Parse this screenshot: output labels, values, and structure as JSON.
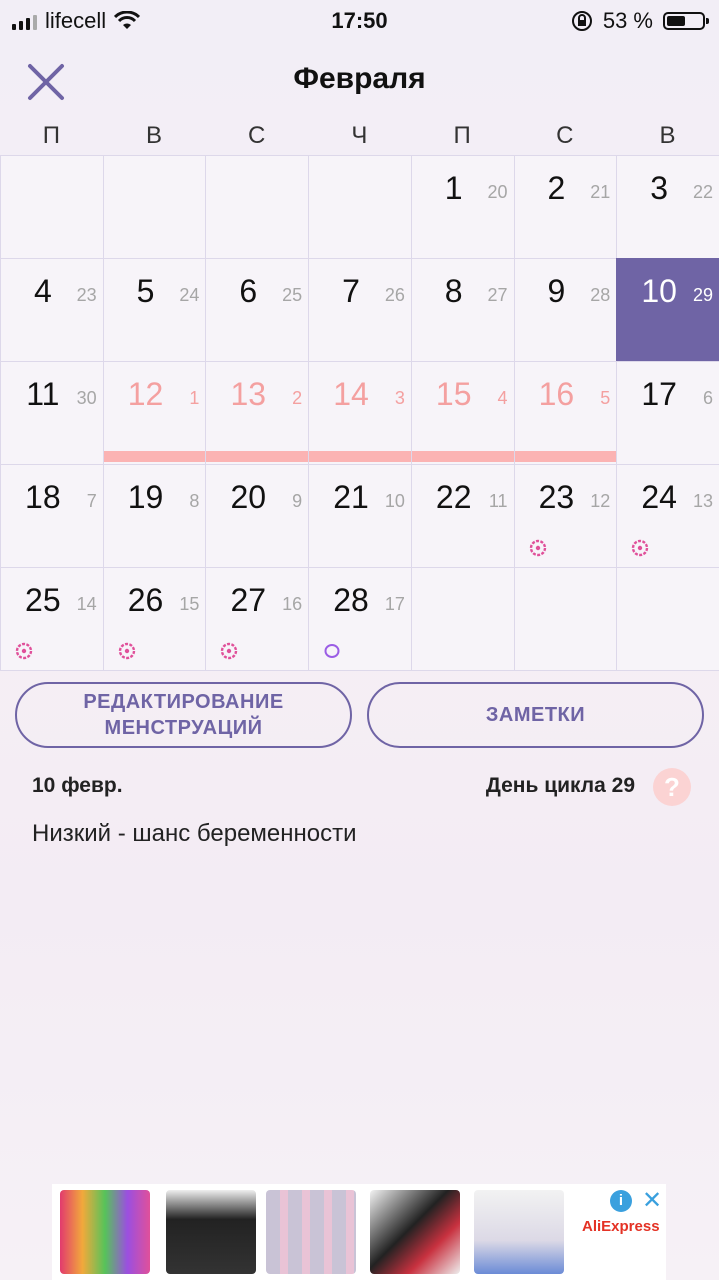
{
  "status_bar": {
    "carrier": "lifecell",
    "time": "17:50",
    "battery": "53 %",
    "battery_level": 0.53
  },
  "header": {
    "title": "Февраля"
  },
  "weekdays": [
    "П",
    "В",
    "С",
    "Ч",
    "П",
    "С",
    "В"
  ],
  "calendar": {
    "weeks": [
      [
        null,
        null,
        null,
        null,
        {
          "day": "1",
          "cycle": "20"
        },
        {
          "day": "2",
          "cycle": "21"
        },
        {
          "day": "3",
          "cycle": "22"
        }
      ],
      [
        {
          "day": "4",
          "cycle": "23"
        },
        {
          "day": "5",
          "cycle": "24"
        },
        {
          "day": "6",
          "cycle": "25"
        },
        {
          "day": "7",
          "cycle": "26"
        },
        {
          "day": "8",
          "cycle": "27"
        },
        {
          "day": "9",
          "cycle": "28"
        },
        {
          "day": "10",
          "cycle": "29",
          "today": true
        }
      ],
      [
        {
          "day": "11",
          "cycle": "30"
        },
        {
          "day": "12",
          "cycle": "1",
          "period": true
        },
        {
          "day": "13",
          "cycle": "2",
          "period": true
        },
        {
          "day": "14",
          "cycle": "3",
          "period": true
        },
        {
          "day": "15",
          "cycle": "4",
          "period": true
        },
        {
          "day": "16",
          "cycle": "5",
          "period": true
        },
        {
          "day": "17",
          "cycle": "6"
        }
      ],
      [
        {
          "day": "18",
          "cycle": "7"
        },
        {
          "day": "19",
          "cycle": "8"
        },
        {
          "day": "20",
          "cycle": "9"
        },
        {
          "day": "21",
          "cycle": "10"
        },
        {
          "day": "22",
          "cycle": "11"
        },
        {
          "day": "23",
          "cycle": "12",
          "fertile": true
        },
        {
          "day": "24",
          "cycle": "13",
          "fertile": true
        }
      ],
      [
        {
          "day": "25",
          "cycle": "14",
          "fertile": true
        },
        {
          "day": "26",
          "cycle": "15",
          "fertile": true
        },
        {
          "day": "27",
          "cycle": "16",
          "fertile": true
        },
        {
          "day": "28",
          "cycle": "17",
          "ovulation": true
        },
        null,
        null,
        null
      ]
    ],
    "colors": {
      "period": "#f4a0a0",
      "today": "#6f64a5",
      "fertile_marker": "#e0509a",
      "ovulation_marker": "#9b5de5"
    }
  },
  "buttons": {
    "edit_periods": "РЕДАКТИРОВАНИЕ МЕНСТРУАЦИЙ",
    "notes": "ЗАМЕТКИ"
  },
  "info": {
    "selected_date": "10 февр.",
    "cycle_day": "День цикла 29",
    "help": "?",
    "chance": "Низкий - шанс беременности"
  },
  "ad": {
    "brand": "AliExpress",
    "info": "i",
    "close": "✕"
  }
}
